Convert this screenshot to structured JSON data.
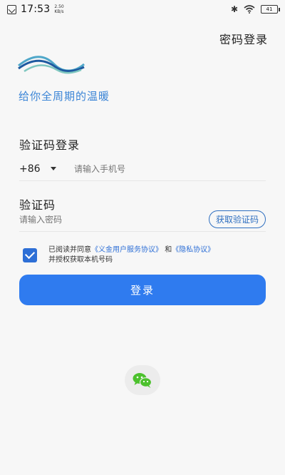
{
  "status_bar": {
    "time": "17:53",
    "speed_value": "2.50",
    "speed_unit": "KB/s",
    "battery": "41"
  },
  "header": {
    "password_login": "密码登录"
  },
  "brand": {
    "slogan": "给你全周期的温暖",
    "accent_color": "#3a84d6"
  },
  "form": {
    "title": "验证码登录",
    "country_code": "+86",
    "phone_placeholder": "请输入手机号",
    "code_label": "验证码",
    "code_placeholder": "请输入密码",
    "get_code_button": "获取验证码"
  },
  "agreement": {
    "checked": true,
    "prefix": "已阅读并同意",
    "service_link": "《义金用户服务协议》",
    "and": "和",
    "privacy_link": "《隐私协议》",
    "line2": "并授权获取本机号码"
  },
  "login_button": "登录",
  "icons": {
    "wechat": "wechat-icon"
  },
  "colors": {
    "primary": "#2f7bef",
    "checkbox": "#2e6fd6",
    "wechat_green": "#4cc12d"
  }
}
